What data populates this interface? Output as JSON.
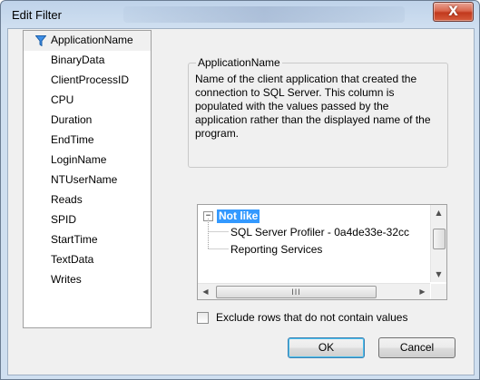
{
  "window": {
    "title": "Edit Filter",
    "close_symbol": "X"
  },
  "columns": {
    "items": [
      "ApplicationName",
      "BinaryData",
      "ClientProcessID",
      "CPU",
      "Duration",
      "EndTime",
      "LoginName",
      "NTUserName",
      "Reads",
      "SPID",
      "StartTime",
      "TextData",
      "Writes"
    ],
    "selected_icon": "filter-icon"
  },
  "description": {
    "heading": "ApplicationName",
    "text": "Name of the client application that created the connection to SQL Server. This column is populated with the values passed by the application rather than the displayed name of the program."
  },
  "filter_tree": {
    "expander": "−",
    "operator": "Not like",
    "values": [
      "SQL Server Profiler - 0a4de33e-32cc",
      "Reporting Services"
    ],
    "scroll": {
      "up": "▲",
      "down": "▼",
      "left": "◀",
      "right": "▶",
      "grip": "III"
    }
  },
  "exclude_checkbox": {
    "label": "Exclude rows that do not contain values"
  },
  "buttons": {
    "ok": "OK",
    "cancel": "Cancel"
  }
}
